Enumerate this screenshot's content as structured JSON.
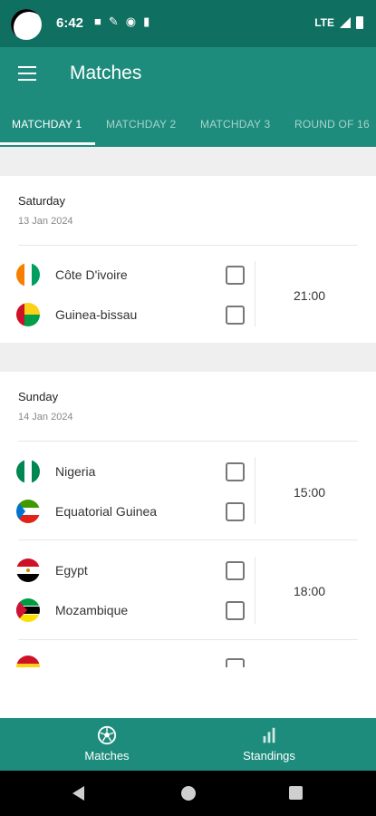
{
  "status": {
    "time": "6:42",
    "network": "LTE"
  },
  "app": {
    "title": "Matches"
  },
  "tabs": [
    {
      "label": "MATCHDAY 1"
    },
    {
      "label": "MATCHDAY 2"
    },
    {
      "label": "MATCHDAY 3"
    },
    {
      "label": "ROUND OF 16"
    }
  ],
  "days": [
    {
      "day": "Saturday",
      "date": "13 Jan 2024",
      "matches": [
        {
          "home": "Côte D'ivoire",
          "away": "Guinea-bissau",
          "time": "21:00"
        }
      ]
    },
    {
      "day": "Sunday",
      "date": "14 Jan 2024",
      "matches": [
        {
          "home": "Nigeria",
          "away": "Equatorial Guinea",
          "time": "15:00"
        },
        {
          "home": "Egypt",
          "away": "Mozambique",
          "time": "18:00"
        }
      ]
    }
  ],
  "nav": {
    "matches": "Matches",
    "standings": "Standings"
  },
  "colors": {
    "primary": "#1e8c7c",
    "status_bar": "#0f6f61"
  }
}
